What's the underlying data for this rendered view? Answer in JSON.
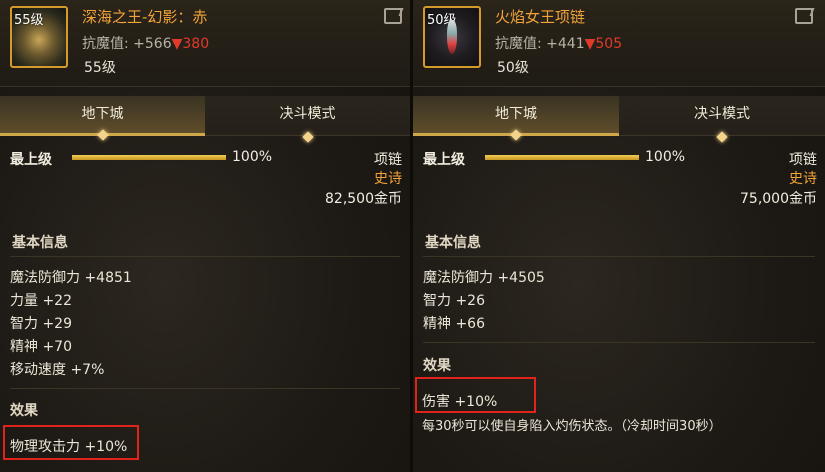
{
  "left": {
    "level_badge": "55级",
    "name": "深海之王-幻影：赤",
    "resist_label": "抗魔值: +566",
    "resist_drop": "▼380",
    "level_req": "55级",
    "tabs": [
      "地下城",
      "决斗模式"
    ],
    "mastery_label": "最上级",
    "mastery_percent": "100%",
    "mastery_fraction": 1.0,
    "slot": "项链",
    "rarity": "史诗",
    "price": "82,500金币",
    "basic_title": "基本信息",
    "stats": [
      "魔法防御力 +4851",
      "力量 +22",
      "智力 +29",
      "精神 +70",
      "移动速度 +7%"
    ],
    "effect_title": "效果",
    "effect_stat": "物理攻击力 +10%"
  },
  "right": {
    "level_badge": "50级",
    "name": "火焰女王项链",
    "resist_label": "抗魔值: +441",
    "resist_drop": "▼505",
    "level_req": "50级",
    "tabs": [
      "地下城",
      "决斗模式"
    ],
    "mastery_label": "最上级",
    "mastery_percent": "100%",
    "mastery_fraction": 1.0,
    "slot": "项链",
    "rarity": "史诗",
    "price": "75,000金币",
    "basic_title": "基本信息",
    "stats": [
      "魔法防御力 +4505",
      "智力 +26",
      "精神 +66"
    ],
    "effect_title": "效果",
    "effect_stat": "伤害 +10%",
    "effect_desc": "每30秒可以使自身陷入灼伤状态。（冷却时间30秒）"
  },
  "colors": {
    "name": "#f2a33a",
    "rarity": "#f2a33a",
    "resist_drop": "#e23a2a",
    "highlight": "#e0241c",
    "bar": "#f2cc55"
  }
}
